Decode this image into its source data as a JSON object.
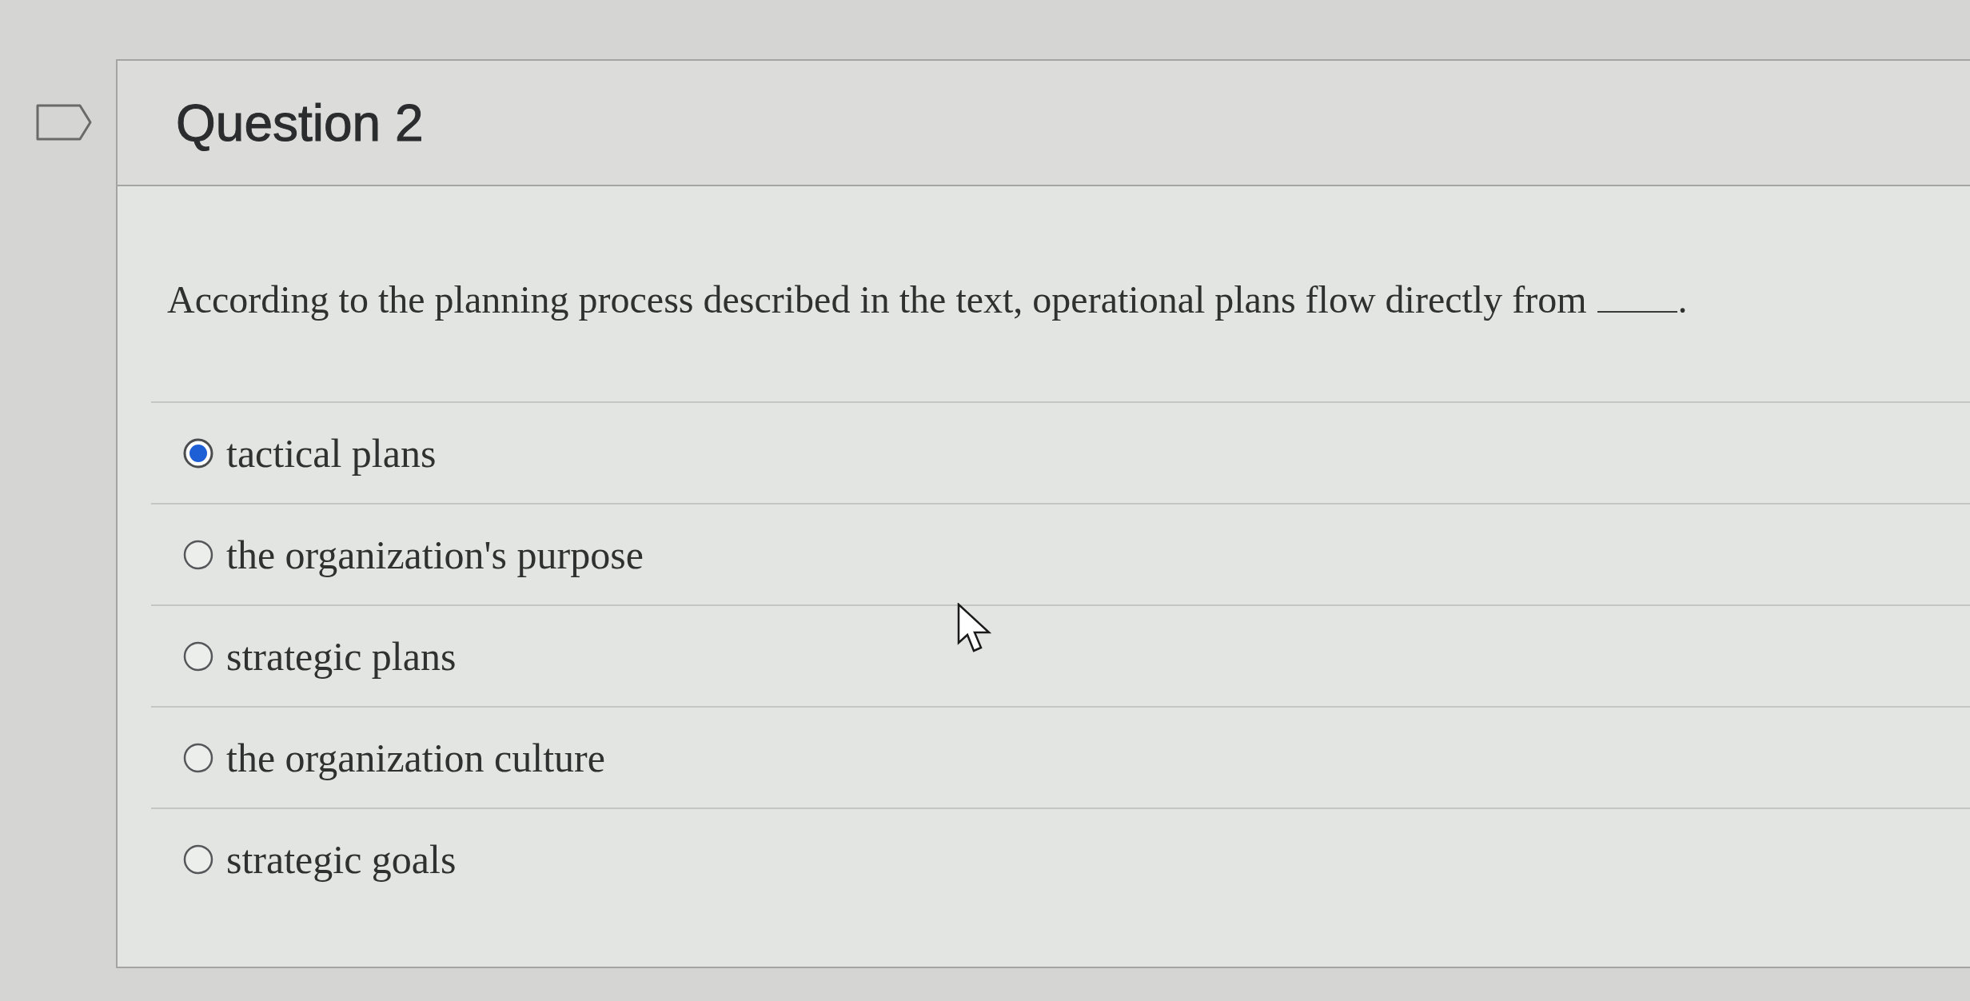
{
  "question": {
    "title": "Question 2",
    "prompt": "According to the planning process described in the text, operational plans flow directly from",
    "prompt_end": "."
  },
  "options": [
    {
      "label": "tactical plans",
      "selected": true
    },
    {
      "label": "the organization's purpose",
      "selected": false
    },
    {
      "label": "strategic plans",
      "selected": false
    },
    {
      "label": "the organization culture",
      "selected": false
    },
    {
      "label": "strategic goals",
      "selected": false
    }
  ]
}
